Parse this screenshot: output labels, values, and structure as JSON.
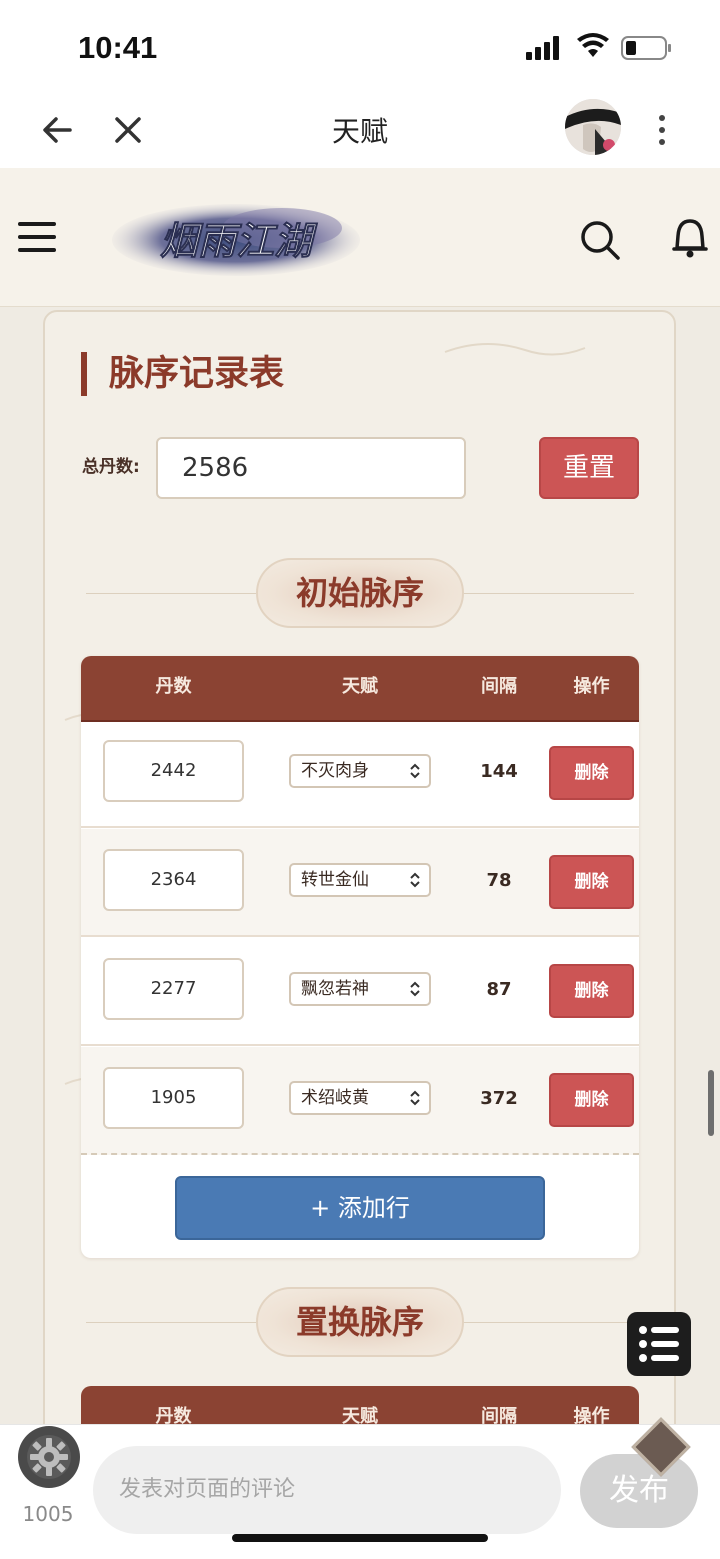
{
  "status_bar": {
    "time": "10:41"
  },
  "nav": {
    "title": "天赋"
  },
  "header": {
    "logo_text": "烟雨江湖"
  },
  "page": {
    "title": "脉序记录表",
    "total_label": "总丹数:",
    "total_value": "2586",
    "reset_label": "重置"
  },
  "section1": {
    "title": "初始脉序",
    "headers": [
      "丹数",
      "天赋",
      "间隔",
      "操作"
    ],
    "rows": [
      {
        "dan": "2442",
        "talent": "不灭肉身",
        "gap": "144",
        "action": "删除"
      },
      {
        "dan": "2364",
        "talent": "转世金仙",
        "gap": "78",
        "action": "删除"
      },
      {
        "dan": "2277",
        "talent": "飘忽若神",
        "gap": "87",
        "action": "删除"
      },
      {
        "dan": "1905",
        "talent": "术绍岐黄",
        "gap": "372",
        "action": "删除"
      }
    ],
    "add_row_label": "+ 添加行"
  },
  "section2": {
    "title": "置换脉序",
    "headers": [
      "丹数",
      "天赋",
      "间隔",
      "操作"
    ]
  },
  "bottom": {
    "count": "1005",
    "comment_placeholder": "发表对页面的评论",
    "publish_label": "发布"
  },
  "colors": {
    "accent": "#8b3a2a",
    "table_header": "#8b4333",
    "delete_button": "#cc5555",
    "add_button": "#4a7ab4"
  }
}
